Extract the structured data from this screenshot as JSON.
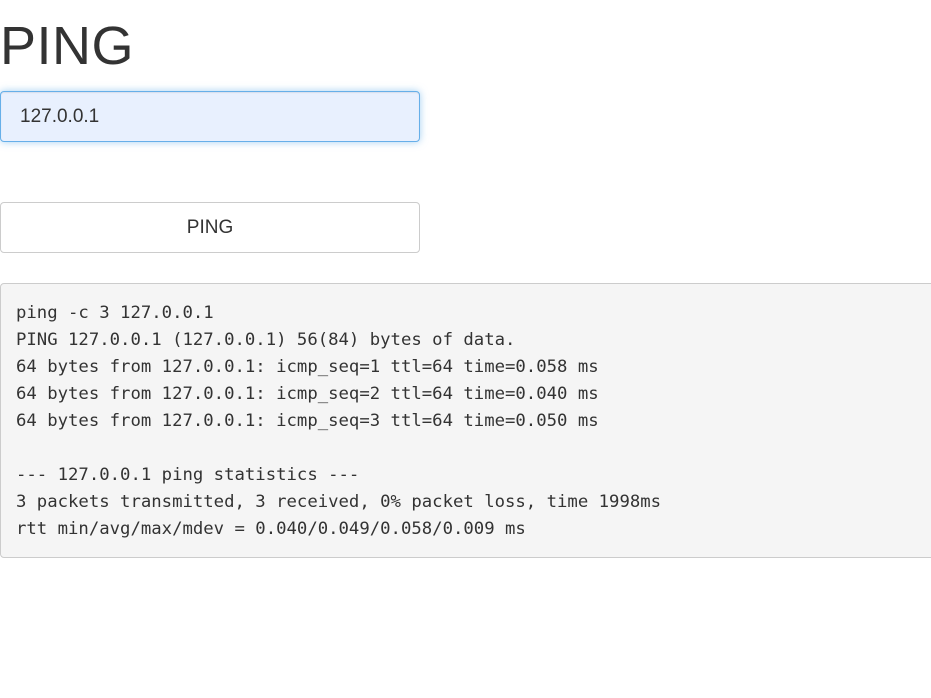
{
  "page": {
    "title": "PING"
  },
  "form": {
    "host_value": "127.0.0.1",
    "ping_label": "PING"
  },
  "output": {
    "lines": [
      "ping -c 3 127.0.0.1",
      "PING 127.0.0.1 (127.0.0.1) 56(84) bytes of data.",
      "64 bytes from 127.0.0.1: icmp_seq=1 ttl=64 time=0.058 ms",
      "64 bytes from 127.0.0.1: icmp_seq=2 ttl=64 time=0.040 ms",
      "64 bytes from 127.0.0.1: icmp_seq=3 ttl=64 time=0.050 ms",
      "",
      "--- 127.0.0.1 ping statistics ---",
      "3 packets transmitted, 3 received, 0% packet loss, time 1998ms",
      "rtt min/avg/max/mdev = 0.040/0.049/0.058/0.009 ms"
    ]
  }
}
